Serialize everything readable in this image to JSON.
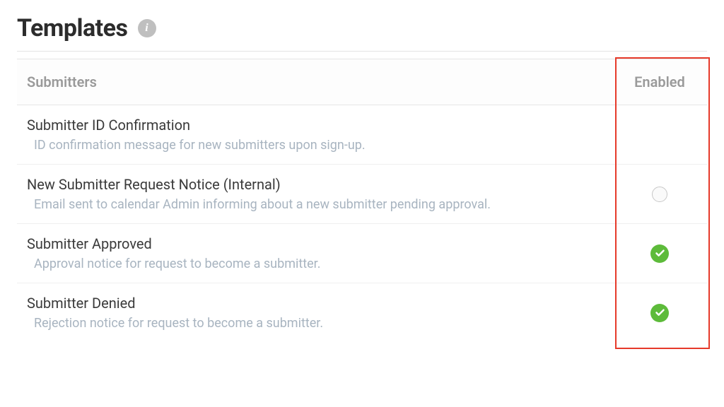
{
  "header": {
    "title": "Templates"
  },
  "table": {
    "column_submitters": "Submitters",
    "column_enabled": "Enabled",
    "rows": [
      {
        "title": "Submitter ID Confirmation",
        "description": "ID confirmation message for new submitters upon sign-up.",
        "enabled_state": "none"
      },
      {
        "title": "New Submitter Request Notice (Internal)",
        "description": "Email sent to calendar Admin informing about a new submitter pending approval.",
        "enabled_state": "unchecked"
      },
      {
        "title": "Submitter Approved",
        "description": "Approval notice for request to become a submitter.",
        "enabled_state": "checked"
      },
      {
        "title": "Submitter Denied",
        "description": "Rejection notice for request to become a submitter.",
        "enabled_state": "checked"
      }
    ]
  }
}
